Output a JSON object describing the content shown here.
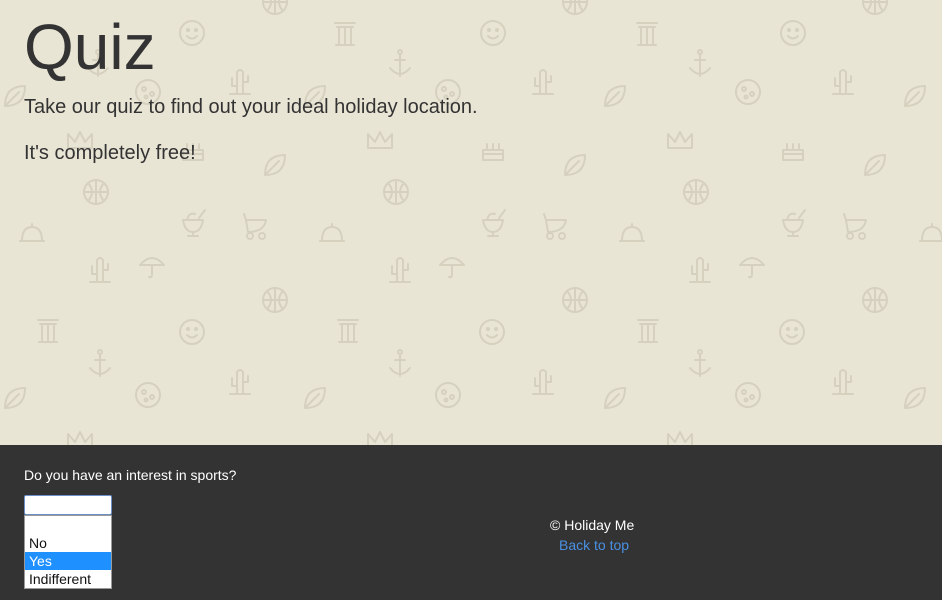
{
  "hero": {
    "title": "Quiz",
    "tagline": "Take our quiz to find out your ideal holiday location.",
    "subtagline": "It's completely free!",
    "background_color": "#e9e5d5",
    "pattern_icons": [
      "smiley-icon",
      "column-icon",
      "anchor-icon",
      "cactus-icon",
      "pizza-icon",
      "leaf-icon",
      "crown-icon",
      "cake-icon",
      "basketball-icon",
      "ice-cream-icon",
      "stroller-icon",
      "cloche-icon",
      "umbrella-icon"
    ]
  },
  "footer": {
    "background_color": "#333333",
    "question": "Do you have an interest in sports?",
    "select": {
      "value": "",
      "options": [
        "",
        "No",
        "Yes",
        "Indifferent"
      ],
      "highlighted": "Yes"
    },
    "copyright": "© Holiday Me",
    "back_to_top": "Back to top",
    "link_color": "#4a90e2"
  }
}
